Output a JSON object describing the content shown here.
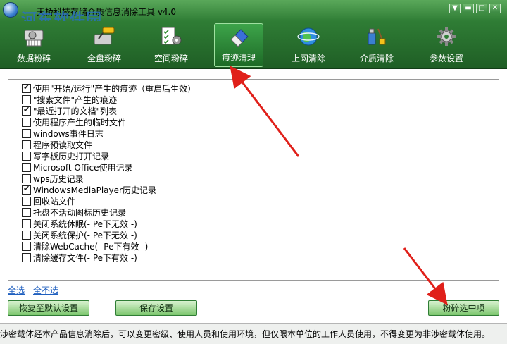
{
  "window": {
    "title": "天桥科技存储介质信息消除工具 v4.0",
    "watermark": "河东软件园",
    "watermark_url": "www.pc0359.cn",
    "menu_glyph": "▼",
    "min_glyph": "▬",
    "max_glyph": "□",
    "close_glyph": "✕"
  },
  "toolbar": {
    "items": [
      {
        "label": "数据粉碎",
        "icon": "hard-disk-shredder-icon"
      },
      {
        "label": "全盘粉碎",
        "icon": "disk-drill-icon"
      },
      {
        "label": "空间粉碎",
        "icon": "checklist-gear-icon"
      },
      {
        "label": "痕迹清理",
        "icon": "eraser-icon",
        "active": true
      },
      {
        "label": "上网清除",
        "icon": "globe-icon"
      },
      {
        "label": "介质清除",
        "icon": "usb-brush-icon"
      },
      {
        "label": "参数设置",
        "icon": "gear-icon"
      }
    ]
  },
  "checklist": {
    "items": [
      {
        "label": "使用\"开始/运行\"产生的痕迹（重启后生效）",
        "checked": true
      },
      {
        "label": "\"搜索文件\"产生的痕迹",
        "checked": false
      },
      {
        "label": "\"最近打开的文档\"列表",
        "checked": true
      },
      {
        "label": "使用程序产生的临时文件",
        "checked": false
      },
      {
        "label": "windows事件日志",
        "checked": false
      },
      {
        "label": "程序预读取文件",
        "checked": false
      },
      {
        "label": "写字板历史打开记录",
        "checked": false
      },
      {
        "label": "Microsoft Office使用记录",
        "checked": false
      },
      {
        "label": "wps历史记录",
        "checked": false
      },
      {
        "label": "WindowsMediaPlayer历史记录",
        "checked": true
      },
      {
        "label": "回收站文件",
        "checked": false
      },
      {
        "label": "托盘不活动图标历史记录",
        "checked": false
      },
      {
        "label": "关闭系统休眠(- Pe下无效 -)",
        "checked": false
      },
      {
        "label": "关闭系统保护(- Pe下无效 -)",
        "checked": false
      },
      {
        "label": "清除WebCache(- Pe下有效 -)",
        "checked": false
      },
      {
        "label": "清除缓存文件(- Pe下有效 -)",
        "checked": false
      }
    ]
  },
  "links": {
    "select_all": "全选",
    "select_none": "全不选"
  },
  "buttons": {
    "restore_defaults": "恢复至默认设置",
    "save_settings": "保存设置",
    "shred_selected": "粉碎选中项"
  },
  "status": {
    "text": "涉密载体经本产品信息消除后，可以变更密级、使用人员和使用环境，但仅限本单位的工作人员使用，不得变更为非涉密载体使用。"
  },
  "colors": {
    "accent_green": "#2f7d35",
    "annotation_red": "#e0201a",
    "link_blue": "#1f5fbf"
  }
}
